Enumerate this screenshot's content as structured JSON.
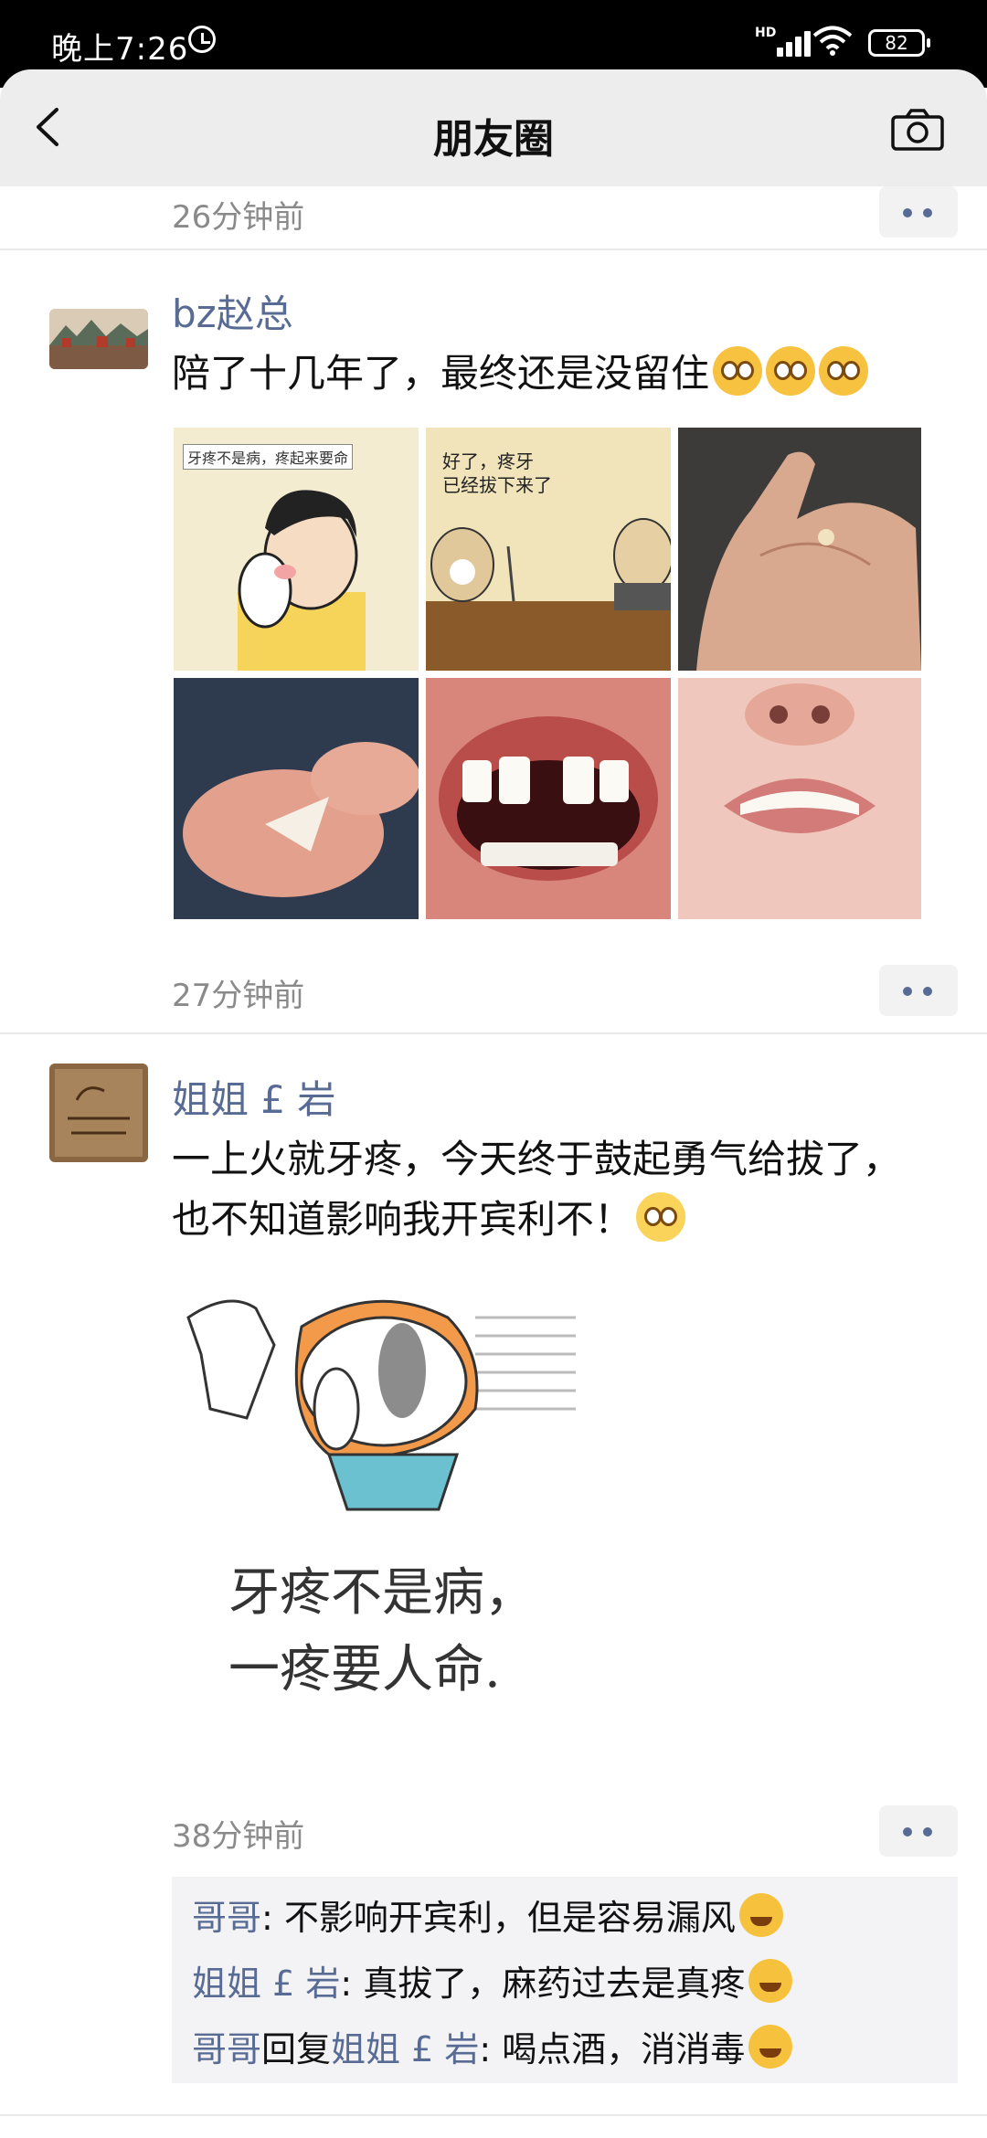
{
  "status_bar": {
    "time": "晚上7:26",
    "network": "HD",
    "battery": "82"
  },
  "nav": {
    "title": "朋友圈"
  },
  "prev_post": {
    "time": "26分钟前"
  },
  "posts": [
    {
      "author": "bz赵总",
      "text": "陪了十几年了，最终还是没留住",
      "time": "27分钟前",
      "photos": [
        {
          "caption_line1": "牙疼不是病，疼起来要命"
        },
        {
          "caption_line1": "好了，疼牙",
          "caption_line2": "已经拔下来了"
        },
        {},
        {},
        {},
        {}
      ]
    },
    {
      "author": "姐姐 £ 岩",
      "text_line1": "一上火就牙疼，今天终于鼓起勇气给拔了，",
      "text_line2": "也不知道影响我开宾利不！",
      "image_caption_line1": "牙疼不是病，",
      "image_caption_line2": "一疼要人命.",
      "time": "38分钟前",
      "comments": [
        {
          "name": "哥哥",
          "sep": ": ",
          "text": "不影响开宾利，但是容易漏风"
        },
        {
          "name": "姐姐 £ 岩",
          "sep": ": ",
          "text": "真拔了，麻药过去是真疼"
        },
        {
          "name": "哥哥",
          "reply": "回复",
          "reply_to": "姐姐 £ 岩",
          "sep": ": ",
          "text": "喝点酒，消消毒"
        }
      ]
    }
  ],
  "colors": {
    "name_blue": "#576b95",
    "nav_bg": "#ededed",
    "time_gray": "#8a8a8a"
  }
}
